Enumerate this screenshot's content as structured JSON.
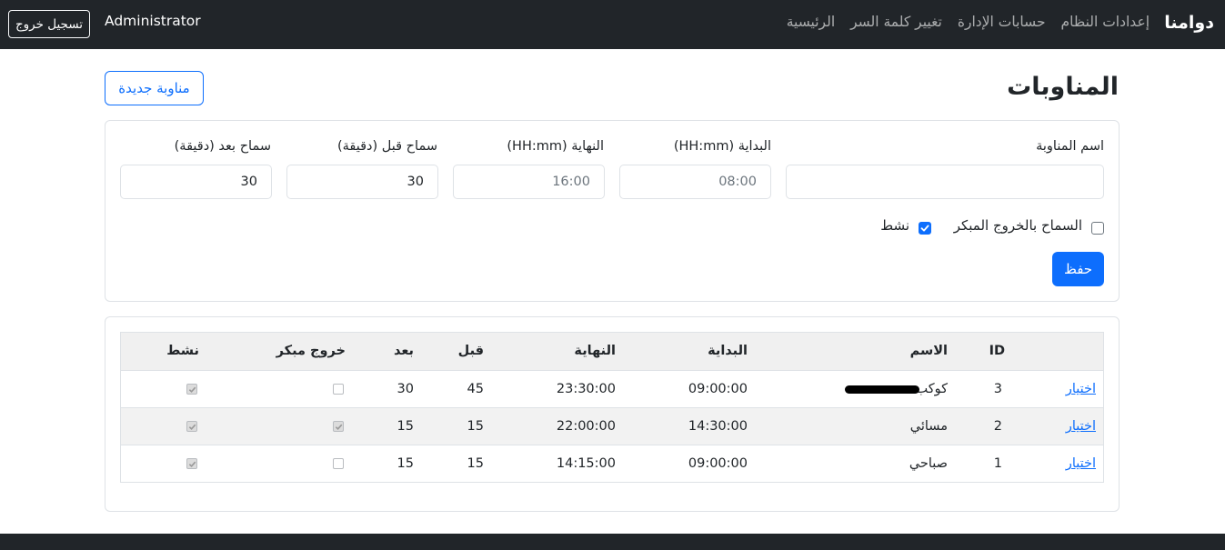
{
  "navbar": {
    "brand": "دوامنا",
    "links": [
      "الرئيسية",
      "تغيير كلمة السر",
      "حسابات الإدارة",
      "إعدادات النظام"
    ],
    "user": "Administrator",
    "logout_label": "تسجيل خروج"
  },
  "page": {
    "title": "المناوبات",
    "new_button": "مناوبة جديدة"
  },
  "form": {
    "name_label": "اسم المناوبة",
    "name_value": "",
    "start_label": "البداية (HH:mm)",
    "start_placeholder": "08:00",
    "end_label": "النهاية (HH:mm)",
    "end_placeholder": "16:00",
    "before_label": "سماح قبل (دقيقة)",
    "before_value": "30",
    "after_label": "سماح بعد (دقيقة)",
    "after_value": "30",
    "early_exit_label": "السماح بالخروج المبكر",
    "early_exit_checked": false,
    "active_label": "نشط",
    "active_checked": true,
    "save_label": "حفظ"
  },
  "table": {
    "headers": {
      "id": "ID",
      "name": "الاسم",
      "start": "البداية",
      "end": "النهاية",
      "before": "قبل",
      "after": "بعد",
      "early_exit": "خروج مبكر",
      "active": "نشط"
    },
    "select_label": "اختيار",
    "rows": [
      {
        "id": "3",
        "name": "كوكب",
        "start": "09:00:00",
        "end": "23:30:00",
        "before": "45",
        "after": "30",
        "early_exit": false,
        "active": true
      },
      {
        "id": "2",
        "name": "مسائي",
        "start": "14:30:00",
        "end": "22:00:00",
        "before": "15",
        "after": "15",
        "early_exit": true,
        "active": true
      },
      {
        "id": "1",
        "name": "صباحي",
        "start": "09:00:00",
        "end": "14:15:00",
        "before": "15",
        "after": "15",
        "early_exit": false,
        "active": true
      }
    ]
  },
  "colors": {
    "navbar_bg": "#212529",
    "primary": "#0d6efd",
    "border": "#dee2e6"
  }
}
